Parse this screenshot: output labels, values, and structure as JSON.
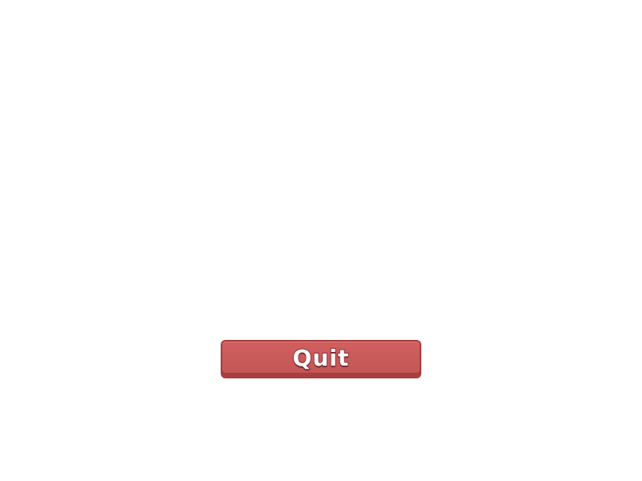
{
  "menu": {
    "quit_label": "Quit"
  },
  "colors": {
    "background": "#ffffff",
    "button_fill": "#c95a5a",
    "button_border": "#a53e3e",
    "label_fill": "#ffffff",
    "label_outline": "#8f2f36"
  }
}
